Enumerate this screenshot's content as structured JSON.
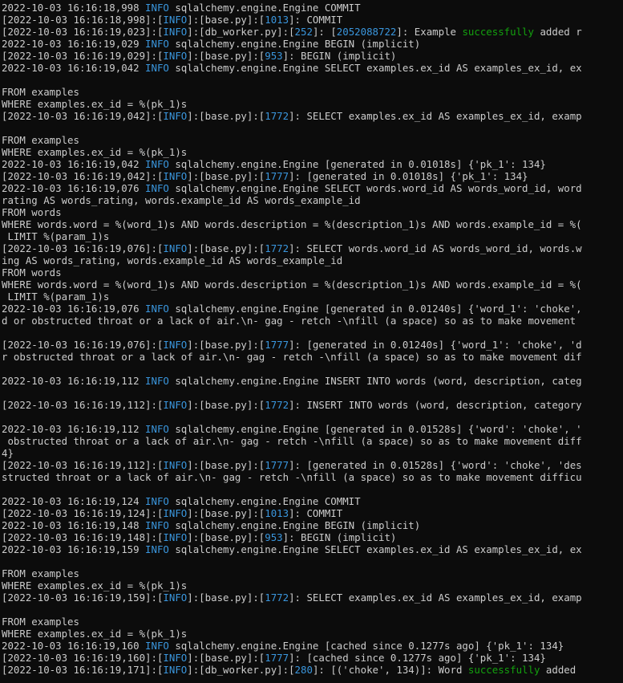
{
  "colors": {
    "background": "#0c0c0c",
    "foreground": "#cccccc",
    "info": "#3a96dd",
    "line_number": "#3a96dd",
    "success": "#13a10e"
  },
  "lines": [
    [
      {
        "t": "2022-10-03 16:16:18,998 "
      },
      {
        "t": "INFO",
        "c": "info"
      },
      {
        "t": " sqlalchemy.engine.Engine COMMIT"
      }
    ],
    [
      {
        "t": "[2022-10-03 16:16:18,998]:["
      },
      {
        "t": "INFO",
        "c": "info"
      },
      {
        "t": "]:[base.py]:["
      },
      {
        "t": "1013",
        "c": "num"
      },
      {
        "t": "]: COMMIT"
      }
    ],
    [
      {
        "t": "[2022-10-03 16:16:19,023]:["
      },
      {
        "t": "INFO",
        "c": "info"
      },
      {
        "t": "]:[db_worker.py]:["
      },
      {
        "t": "252",
        "c": "num"
      },
      {
        "t": "]: ["
      },
      {
        "t": "2052088722",
        "c": "num"
      },
      {
        "t": "]: Example "
      },
      {
        "t": "successfully",
        "c": "ok"
      },
      {
        "t": " added r"
      }
    ],
    [
      {
        "t": "2022-10-03 16:16:19,029 "
      },
      {
        "t": "INFO",
        "c": "info"
      },
      {
        "t": " sqlalchemy.engine.Engine BEGIN (implicit)"
      }
    ],
    [
      {
        "t": "[2022-10-03 16:16:19,029]:["
      },
      {
        "t": "INFO",
        "c": "info"
      },
      {
        "t": "]:[base.py]:["
      },
      {
        "t": "953",
        "c": "num"
      },
      {
        "t": "]: BEGIN (implicit)"
      }
    ],
    [
      {
        "t": "2022-10-03 16:16:19,042 "
      },
      {
        "t": "INFO",
        "c": "info"
      },
      {
        "t": " sqlalchemy.engine.Engine SELECT examples.ex_id AS examples_ex_id, ex"
      }
    ],
    [
      {
        "t": ""
      }
    ],
    [
      {
        "t": "FROM examples"
      }
    ],
    [
      {
        "t": "WHERE examples.ex_id = %(pk_1)s"
      }
    ],
    [
      {
        "t": "[2022-10-03 16:16:19,042]:["
      },
      {
        "t": "INFO",
        "c": "info"
      },
      {
        "t": "]:[base.py]:["
      },
      {
        "t": "1772",
        "c": "num"
      },
      {
        "t": "]: SELECT examples.ex_id AS examples_ex_id, examp"
      }
    ],
    [
      {
        "t": ""
      }
    ],
    [
      {
        "t": "FROM examples"
      }
    ],
    [
      {
        "t": "WHERE examples.ex_id = %(pk_1)s"
      }
    ],
    [
      {
        "t": "2022-10-03 16:16:19,042 "
      },
      {
        "t": "INFO",
        "c": "info"
      },
      {
        "t": " sqlalchemy.engine.Engine [generated in 0.01018s] {'pk_1': 134}"
      }
    ],
    [
      {
        "t": "[2022-10-03 16:16:19,042]:["
      },
      {
        "t": "INFO",
        "c": "info"
      },
      {
        "t": "]:[base.py]:["
      },
      {
        "t": "1777",
        "c": "num"
      },
      {
        "t": "]: [generated in 0.01018s] {'pk_1': 134}"
      }
    ],
    [
      {
        "t": "2022-10-03 16:16:19,076 "
      },
      {
        "t": "INFO",
        "c": "info"
      },
      {
        "t": " sqlalchemy.engine.Engine SELECT words.word_id AS words_word_id, word"
      }
    ],
    [
      {
        "t": "rating AS words_rating, words.example_id AS words_example_id"
      }
    ],
    [
      {
        "t": "FROM words"
      }
    ],
    [
      {
        "t": "WHERE words.word = %(word_1)s AND words.description = %(description_1)s AND words.example_id = %("
      }
    ],
    [
      {
        "t": " LIMIT %(param_1)s"
      }
    ],
    [
      {
        "t": "[2022-10-03 16:16:19,076]:["
      },
      {
        "t": "INFO",
        "c": "info"
      },
      {
        "t": "]:[base.py]:["
      },
      {
        "t": "1772",
        "c": "num"
      },
      {
        "t": "]: SELECT words.word_id AS words_word_id, words.w"
      }
    ],
    [
      {
        "t": "ing AS words_rating, words.example_id AS words_example_id"
      }
    ],
    [
      {
        "t": "FROM words"
      }
    ],
    [
      {
        "t": "WHERE words.word = %(word_1)s AND words.description = %(description_1)s AND words.example_id = %("
      }
    ],
    [
      {
        "t": " LIMIT %(param_1)s"
      }
    ],
    [
      {
        "t": "2022-10-03 16:16:19,076 "
      },
      {
        "t": "INFO",
        "c": "info"
      },
      {
        "t": " sqlalchemy.engine.Engine [generated in 0.01240s] {'word_1': 'choke',"
      }
    ],
    [
      {
        "t": "d or obstructed throat or a lack of air.\\n- gag - retch -\\nfill (a space) so as to make movement"
      }
    ],
    [
      {
        "t": ""
      }
    ],
    [
      {
        "t": "[2022-10-03 16:16:19,076]:["
      },
      {
        "t": "INFO",
        "c": "info"
      },
      {
        "t": "]:[base.py]:["
      },
      {
        "t": "1777",
        "c": "num"
      },
      {
        "t": "]: [generated in 0.01240s] {'word_1': 'choke', 'd"
      }
    ],
    [
      {
        "t": "r obstructed throat or a lack of air.\\n- gag - retch -\\nfill (a space) so as to make movement dif"
      }
    ],
    [
      {
        "t": ""
      }
    ],
    [
      {
        "t": "2022-10-03 16:16:19,112 "
      },
      {
        "t": "INFO",
        "c": "info"
      },
      {
        "t": " sqlalchemy.engine.Engine INSERT INTO words (word, description, categ"
      }
    ],
    [
      {
        "t": ""
      }
    ],
    [
      {
        "t": "[2022-10-03 16:16:19,112]:["
      },
      {
        "t": "INFO",
        "c": "info"
      },
      {
        "t": "]:[base.py]:["
      },
      {
        "t": "1772",
        "c": "num"
      },
      {
        "t": "]: INSERT INTO words (word, description, category"
      }
    ],
    [
      {
        "t": ""
      }
    ],
    [
      {
        "t": "2022-10-03 16:16:19,112 "
      },
      {
        "t": "INFO",
        "c": "info"
      },
      {
        "t": " sqlalchemy.engine.Engine [generated in 0.01528s] {'word': 'choke', '"
      }
    ],
    [
      {
        "t": " obstructed throat or a lack of air.\\n- gag - retch -\\nfill (a space) so as to make movement diff"
      }
    ],
    [
      {
        "t": "4}"
      }
    ],
    [
      {
        "t": "[2022-10-03 16:16:19,112]:["
      },
      {
        "t": "INFO",
        "c": "info"
      },
      {
        "t": "]:[base.py]:["
      },
      {
        "t": "1777",
        "c": "num"
      },
      {
        "t": "]: [generated in 0.01528s] {'word': 'choke', 'des"
      }
    ],
    [
      {
        "t": "structed throat or a lack of air.\\n- gag - retch -\\nfill (a space) so as to make movement difficu"
      }
    ],
    [
      {
        "t": ""
      }
    ],
    [
      {
        "t": "2022-10-03 16:16:19,124 "
      },
      {
        "t": "INFO",
        "c": "info"
      },
      {
        "t": " sqlalchemy.engine.Engine COMMIT"
      }
    ],
    [
      {
        "t": "[2022-10-03 16:16:19,124]:["
      },
      {
        "t": "INFO",
        "c": "info"
      },
      {
        "t": "]:[base.py]:["
      },
      {
        "t": "1013",
        "c": "num"
      },
      {
        "t": "]: COMMIT"
      }
    ],
    [
      {
        "t": "2022-10-03 16:16:19,148 "
      },
      {
        "t": "INFO",
        "c": "info"
      },
      {
        "t": " sqlalchemy.engine.Engine BEGIN (implicit)"
      }
    ],
    [
      {
        "t": "[2022-10-03 16:16:19,148]:["
      },
      {
        "t": "INFO",
        "c": "info"
      },
      {
        "t": "]:[base.py]:["
      },
      {
        "t": "953",
        "c": "num"
      },
      {
        "t": "]: BEGIN (implicit)"
      }
    ],
    [
      {
        "t": "2022-10-03 16:16:19,159 "
      },
      {
        "t": "INFO",
        "c": "info"
      },
      {
        "t": " sqlalchemy.engine.Engine SELECT examples.ex_id AS examples_ex_id, ex"
      }
    ],
    [
      {
        "t": ""
      }
    ],
    [
      {
        "t": "FROM examples"
      }
    ],
    [
      {
        "t": "WHERE examples.ex_id = %(pk_1)s"
      }
    ],
    [
      {
        "t": "[2022-10-03 16:16:19,159]:["
      },
      {
        "t": "INFO",
        "c": "info"
      },
      {
        "t": "]:[base.py]:["
      },
      {
        "t": "1772",
        "c": "num"
      },
      {
        "t": "]: SELECT examples.ex_id AS examples_ex_id, examp"
      }
    ],
    [
      {
        "t": ""
      }
    ],
    [
      {
        "t": "FROM examples"
      }
    ],
    [
      {
        "t": "WHERE examples.ex_id = %(pk_1)s"
      }
    ],
    [
      {
        "t": "2022-10-03 16:16:19,160 "
      },
      {
        "t": "INFO",
        "c": "info"
      },
      {
        "t": " sqlalchemy.engine.Engine [cached since 0.1277s ago] {'pk_1': 134}"
      }
    ],
    [
      {
        "t": "[2022-10-03 16:16:19,160]:["
      },
      {
        "t": "INFO",
        "c": "info"
      },
      {
        "t": "]:[base.py]:["
      },
      {
        "t": "1777",
        "c": "num"
      },
      {
        "t": "]: [cached since 0.1277s ago] {'pk_1': 134}"
      }
    ],
    [
      {
        "t": "[2022-10-03 16:16:19,171]:["
      },
      {
        "t": "INFO",
        "c": "info"
      },
      {
        "t": "]:[db_worker.py]:["
      },
      {
        "t": "280",
        "c": "num"
      },
      {
        "t": "]: [('choke', 134)]: Word "
      },
      {
        "t": "successfully",
        "c": "ok"
      },
      {
        "t": " added"
      }
    ]
  ]
}
